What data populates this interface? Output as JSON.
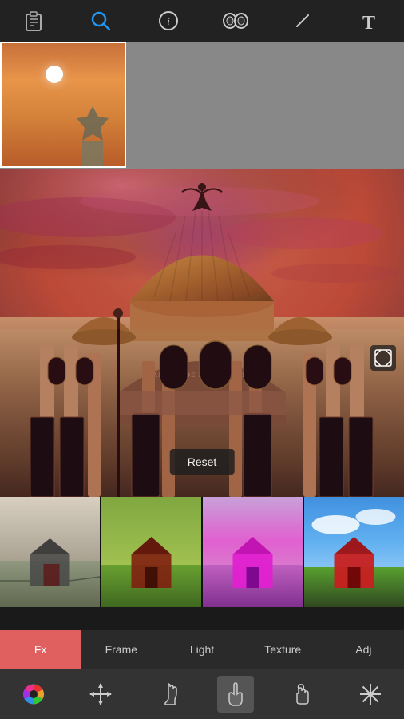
{
  "toolbar": {
    "icons": [
      {
        "name": "clipboard-icon",
        "symbol": "📋",
        "interactable": true
      },
      {
        "name": "search-icon",
        "symbol": "🔍",
        "active": true,
        "interactable": true
      },
      {
        "name": "info-icon",
        "symbol": "ℹ",
        "interactable": true
      },
      {
        "name": "mask-icon",
        "symbol": "⬡",
        "interactable": true
      },
      {
        "name": "pen-icon",
        "symbol": "/",
        "interactable": true
      },
      {
        "name": "text-icon",
        "symbol": "T",
        "interactable": true
      }
    ]
  },
  "reset_button": {
    "label": "Reset"
  },
  "filter_strip": {
    "filters": [
      {
        "name": "bw-filter",
        "label": ""
      },
      {
        "name": "warm-filter",
        "label": ""
      },
      {
        "name": "purple-filter",
        "label": ""
      },
      {
        "name": "vivid-filter",
        "label": ""
      }
    ]
  },
  "tabs": [
    {
      "id": "fx",
      "label": "Fx",
      "active": true
    },
    {
      "id": "frame",
      "label": "Frame",
      "active": false
    },
    {
      "id": "light",
      "label": "Light",
      "active": false
    },
    {
      "id": "texture",
      "label": "Texture",
      "active": false
    },
    {
      "id": "adj",
      "label": "Adj",
      "active": false
    }
  ],
  "bottom_icons": [
    {
      "name": "color-wheel-icon",
      "interactable": true
    },
    {
      "name": "move-icon",
      "interactable": true
    },
    {
      "name": "hand-icon",
      "interactable": true
    },
    {
      "name": "touch-icon",
      "interactable": true,
      "active": true
    },
    {
      "name": "gesture-icon",
      "interactable": true
    },
    {
      "name": "star-icon",
      "interactable": true
    }
  ],
  "main_image_alt": "Palacio de Bellas Artes with dramatic sunset sky",
  "arch_label": "PALACIO DE BELLAS ARTES"
}
